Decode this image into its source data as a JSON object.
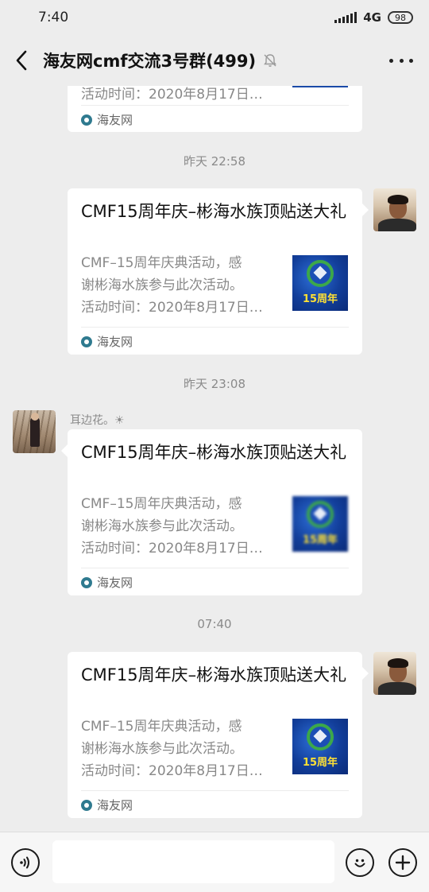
{
  "status_bar": {
    "time": "7:40",
    "network": "4G",
    "battery": "98"
  },
  "header": {
    "title": "海友网cmf交流3号群(499)",
    "back_icon": "chevron-left-icon",
    "mute_icon": "bell-muted-icon",
    "more_icon": "more-dots-icon"
  },
  "messages": [
    {
      "type": "link_card",
      "partial": true,
      "desc": "活动时间：2020年8月17日…",
      "source": "海友网"
    },
    {
      "type": "timestamp",
      "text": "昨天 22:58"
    },
    {
      "type": "link_card",
      "from": "self",
      "title": "CMF15周年庆–彬海水族顶贴送大礼",
      "desc": "CMF–15周年庆典活动，感\n谢彬海水族参与此次活动。\n活动时间：2020年8月17日…",
      "thumb_text": "15周年",
      "source": "海友网"
    },
    {
      "type": "timestamp",
      "text": "昨天 23:08"
    },
    {
      "type": "link_card",
      "from": "other",
      "sender": "耳边花。☀",
      "title": "CMF15周年庆–彬海水族顶贴送大礼",
      "desc": "CMF–15周年庆典活动，感\n谢彬海水族参与此次活动。\n活动时间：2020年8月17日…",
      "thumb_text": "15周年",
      "source": "海友网"
    },
    {
      "type": "timestamp",
      "text": "07:40"
    },
    {
      "type": "link_card",
      "from": "self",
      "title": "CMF15周年庆–彬海水族顶贴送大礼",
      "desc": "CMF–15周年庆典活动，感\n谢彬海水族参与此次活动。\n活动时间：2020年8月17日…",
      "thumb_text": "15周年",
      "source": "海友网"
    }
  ],
  "input_bar": {
    "voice_icon": "voice-icon",
    "emoji_icon": "emoji-icon",
    "plus_icon": "plus-icon",
    "placeholder": ""
  }
}
